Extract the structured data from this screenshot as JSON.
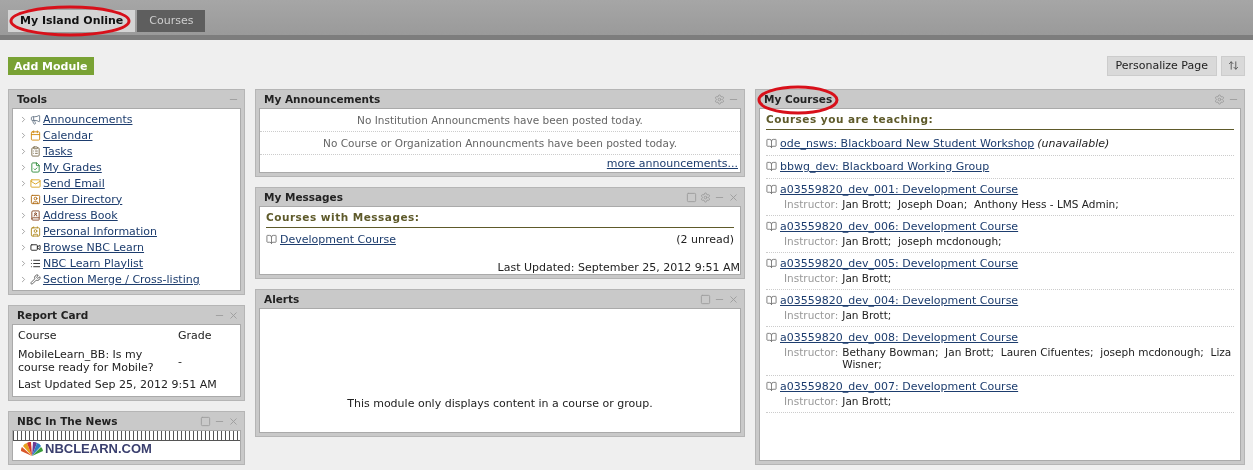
{
  "tabs": [
    {
      "label": "My Island Online",
      "selected": true
    },
    {
      "label": "Courses",
      "selected": false
    }
  ],
  "toolbar": {
    "add_module": "Add Module",
    "personalize": "Personalize Page"
  },
  "tools": {
    "title": "Tools",
    "items": [
      {
        "label": "Announcements"
      },
      {
        "label": "Calendar"
      },
      {
        "label": "Tasks"
      },
      {
        "label": "My Grades"
      },
      {
        "label": "Send Email"
      },
      {
        "label": "User Directory"
      },
      {
        "label": "Address Book"
      },
      {
        "label": "Personal Information"
      },
      {
        "label": "Browse NBC Learn"
      },
      {
        "label": "NBC Learn Playlist"
      },
      {
        "label": "Section Merge / Cross-listing"
      }
    ]
  },
  "report_card": {
    "title": "Report Card",
    "columns": [
      "Course",
      "Grade"
    ],
    "rows": [
      {
        "course": "MobileLearn_BB: Is my course ready for Mobile?",
        "grade": "-"
      }
    ],
    "updated": "Last Updated Sep 25, 2012 9:51 AM"
  },
  "nbc_news": {
    "title": "NBC In The News",
    "logo_text": "NBCLEARN.COM"
  },
  "announcements": {
    "title": "My Announcements",
    "lines": [
      "No Institution Announcments have been posted today.",
      "No Course or Organization Announcments have been posted today."
    ],
    "more": "more announcements..."
  },
  "messages": {
    "title": "My Messages",
    "heading": "Courses with Messages:",
    "items": [
      {
        "course": "Development Course",
        "count": "(2 unread)"
      }
    ],
    "updated": "Last Updated: September 25, 2012 9:51 AM"
  },
  "alerts": {
    "title": "Alerts",
    "message": "This module only displays content in a course or group."
  },
  "my_courses": {
    "title": "My Courses",
    "heading": "Courses you are teaching:",
    "courses": [
      {
        "name": "ode_nsws: Blackboard New Student Workshop",
        "status": "(unavailable)"
      },
      {
        "name": "bbwg_dev: Blackboard Working Group"
      },
      {
        "name": "a03559820_dev_001: Development Course",
        "instructor_label": "Instructor:",
        "instructors": "Jan Brott;  Joseph Doan;  Anthony Hess - LMS Admin;"
      },
      {
        "name": "a03559820_dev_006: Development Course",
        "instructor_label": "Instructor:",
        "instructors": "Jan Brott;  joseph mcdonough;"
      },
      {
        "name": "a03559820_dev_005: Development Course",
        "instructor_label": "Instructor:",
        "instructors": "Jan Brott;"
      },
      {
        "name": "a03559820_dev_004: Development Course",
        "instructor_label": "Instructor:",
        "instructors": "Jan Brott;"
      },
      {
        "name": "a03559820_dev_008: Development Course",
        "instructor_label": "Instructor:",
        "instructors": "Bethany Bowman;  Jan Brott;  Lauren Cifuentes;  joseph mcdonough;  Liza Wisner;"
      },
      {
        "name": "a03559820_dev_007: Development Course",
        "instructor_label": "Instructor:",
        "instructors": "Jan Brott;"
      }
    ]
  }
}
